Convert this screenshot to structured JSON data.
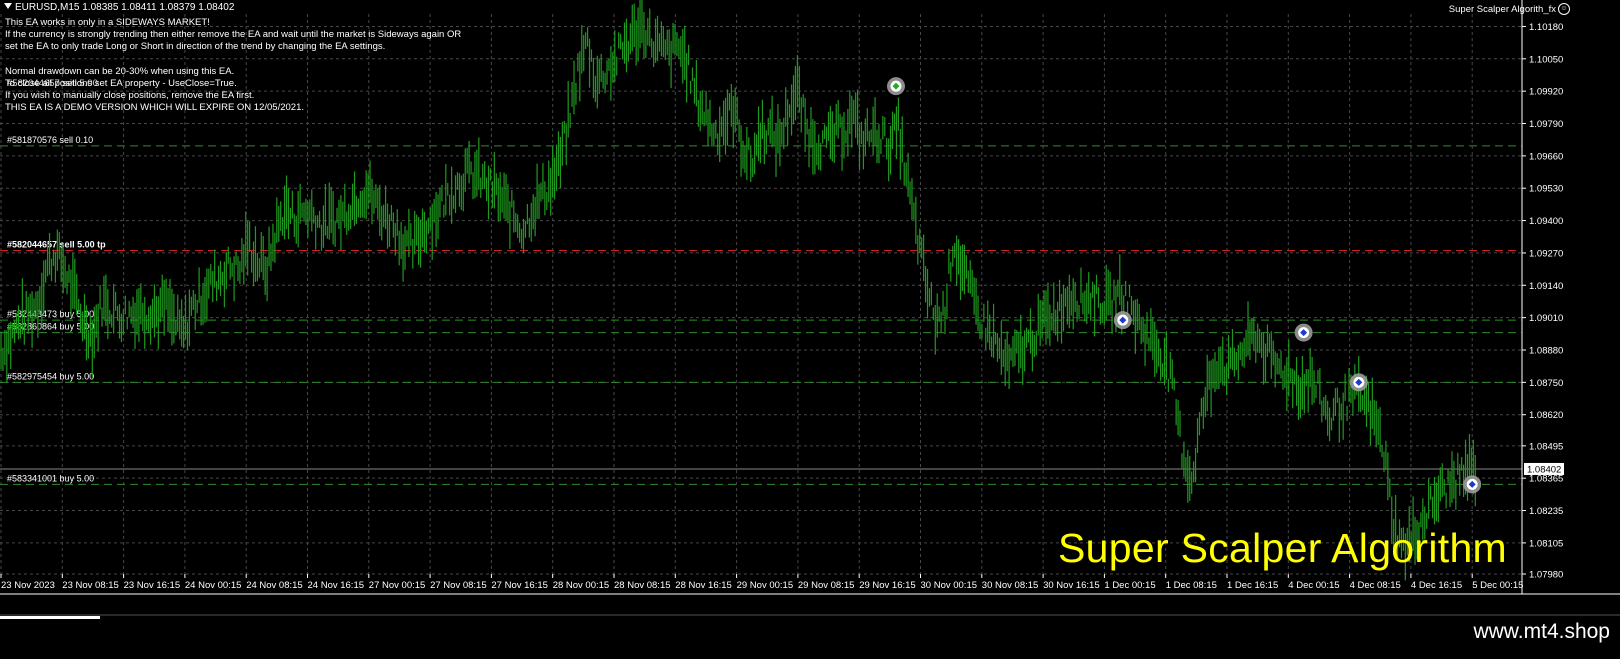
{
  "chart_header": {
    "symbol_line": "EURUSD,M15  1.08385 1.08411 1.08379 1.08402",
    "ea_name": "Super Scalper Algorith_fx"
  },
  "ea_comment": {
    "lines": [
      "This EA works in only in a SIDEWAYS MARKET!",
      "If the currency is strongly trending then either remove the EA and wait until the market is Sideways again OR",
      "set the EA to only trade Long or Short in direction of the trend by changing the EA settings.",
      "",
      "Normal drawdown can be 20-30% when using this EA.",
      "To close all positions set EA property - UseClose=True.",
      "If you wish to manually close positions, remove the EA first.",
      "THIS EA IS A DEMO VERSION WHICH WILL EXPIRE ON 12/05/2021."
    ],
    "overlap_label": "#582044657 sell 5.00"
  },
  "watermark": "Super Scalper Algorithm",
  "site": "www.mt4.shop",
  "colors": {
    "background": "#000000",
    "candles": "#1f9a1f",
    "grid": "#474747",
    "order_line": "#2e8b2e",
    "tp_line": "#d02020",
    "watermark": "#ffff00",
    "text": "#ffffff"
  },
  "chart_data": {
    "type": "line",
    "symbol": "EURUSD",
    "timeframe": "M15",
    "current_price": 1.08402,
    "ylim": [
      1.0798,
      1.1023
    ],
    "y_ticks": [
      "1.10180",
      "1.10050",
      "1.09920",
      "1.09790",
      "1.09660",
      "1.09530",
      "1.09400",
      "1.09270",
      "1.09140",
      "1.09010",
      "1.08880",
      "1.08750",
      "1.08620",
      "1.08495",
      "1.08365",
      "1.08235",
      "1.08105",
      "1.07980"
    ],
    "x_ticks": [
      "23 Nov 2023",
      "23 Nov 08:15",
      "23 Nov 16:15",
      "24 Nov 00:15",
      "24 Nov 08:15",
      "24 Nov 16:15",
      "27 Nov 00:15",
      "27 Nov 08:15",
      "27 Nov 16:15",
      "28 Nov 00:15",
      "28 Nov 08:15",
      "28 Nov 16:15",
      "29 Nov 00:15",
      "29 Nov 08:15",
      "29 Nov 16:15",
      "30 Nov 00:15",
      "30 Nov 08:15",
      "30 Nov 16:15",
      "1 Dec 00:15",
      "1 Dec 08:15",
      "1 Dec 16:15",
      "4 Dec 00:15",
      "4 Dec 08:15",
      "4 Dec 16:15",
      "5 Dec 00:15"
    ],
    "price_path": [
      1.0888,
      1.0892,
      1.0899,
      1.0903,
      1.0906,
      1.0922,
      1.0927,
      1.092,
      1.091,
      1.09,
      1.0893,
      1.0907,
      1.0905,
      1.0902,
      1.0903,
      1.0904,
      1.0904,
      1.0903,
      1.0906,
      1.0898,
      1.0895,
      1.0906,
      1.091,
      1.0915,
      1.0918,
      1.0922,
      1.092,
      1.0931,
      1.0924,
      1.092,
      1.0935,
      1.0945,
      1.0941,
      1.0944,
      1.0943,
      1.0938,
      1.094,
      1.0941,
      1.0946,
      1.095,
      1.0953,
      1.0946,
      1.0942,
      1.0939,
      1.093,
      1.0929,
      1.0936,
      1.0941,
      1.0946,
      1.0952,
      1.0955,
      1.0959,
      1.0958,
      1.0954,
      1.0952,
      1.0946,
      1.0942,
      1.0936,
      1.0945,
      1.095,
      1.0955,
      1.0963,
      1.098,
      1.1,
      1.1012,
      1.0996,
      1.1,
      1.1004,
      1.101,
      1.1014,
      1.102,
      1.1012,
      1.1009,
      1.1007,
      1.101,
      1.1002,
      1.0989,
      1.0982,
      1.0975,
      1.098,
      1.0985,
      1.097,
      1.0963,
      1.0977,
      1.0975,
      1.0972,
      1.0985,
      1.0992,
      1.0976,
      1.0972,
      1.0971,
      1.0974,
      1.0977,
      1.0982,
      1.0972,
      1.0975,
      1.0975,
      1.097,
      1.0977,
      1.0955,
      1.0935,
      1.0915,
      1.09,
      1.0903,
      1.0932,
      1.092,
      1.091,
      1.09,
      1.0895,
      1.0888,
      1.0881,
      1.0887,
      1.089,
      1.0895,
      1.09,
      1.0903,
      1.0907,
      1.0911,
      1.0908,
      1.091,
      1.0908,
      1.0905,
      1.0911,
      1.0909,
      1.09,
      1.0895,
      1.089,
      1.0885,
      1.0872,
      1.0848,
      1.0835,
      1.086,
      1.0875,
      1.0885,
      1.088,
      1.0885,
      1.089,
      1.0894,
      1.0888,
      1.0882,
      1.088,
      1.0877,
      1.0873,
      1.0877,
      1.087,
      1.086,
      1.0865,
      1.0868,
      1.087,
      1.0867,
      1.086,
      1.0848,
      1.082,
      1.0808,
      1.0812,
      1.0818,
      1.0825,
      1.083,
      1.0833,
      1.0836,
      1.0839,
      1.084
    ],
    "horizontal_lines": [
      {
        "label": "#581870576 sell 0.10",
        "price": 1.097,
        "style": "green-dashed"
      },
      {
        "label": "#582044657 sell 5.00 tp",
        "price": 1.0928,
        "style": "red-dashed"
      },
      {
        "label": "#582443473 buy 5.00",
        "price": 1.09,
        "style": "green-dashed"
      },
      {
        "label": "#582860864 buy 5.00",
        "price": 1.0895,
        "style": "green-dashed"
      },
      {
        "label": "#582975454 buy 5.00",
        "price": 1.0875,
        "style": "green-dashed"
      },
      {
        "label": "#583341001 buy 5.00",
        "price": 1.0834,
        "style": "green-dashed"
      }
    ],
    "trade_markers": [
      {
        "time_index": 14.6,
        "price": 1.0994,
        "kind": "sell"
      },
      {
        "time_index": 18.3,
        "price": 1.09,
        "kind": "buy"
      },
      {
        "time_index": 21.25,
        "price": 1.0895,
        "kind": "buy"
      },
      {
        "time_index": 22.15,
        "price": 1.0875,
        "kind": "buy"
      },
      {
        "time_index": 24.0,
        "price": 1.0834,
        "kind": "buy"
      }
    ]
  }
}
